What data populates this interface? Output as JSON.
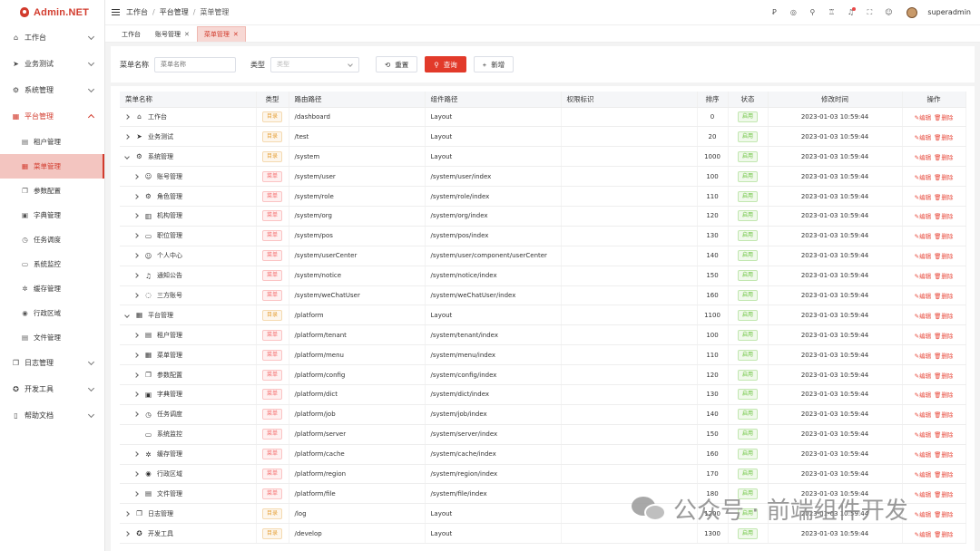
{
  "app": {
    "logo_text": "Admin.NET"
  },
  "sidebar": {
    "items": [
      {
        "label": "工作台",
        "icon": "home-icon",
        "glyph": "⌂"
      },
      {
        "label": "业务测试",
        "icon": "send-icon",
        "glyph": "➤"
      },
      {
        "label": "系统管理",
        "icon": "settings-icon",
        "glyph": "⚙"
      },
      {
        "label": "平台管理",
        "icon": "grid-icon",
        "glyph": "▦"
      }
    ],
    "sub_items": [
      {
        "label": "租户管理",
        "icon": "tenant-icon",
        "glyph": "▤"
      },
      {
        "label": "菜单管理",
        "icon": "menu-grid-icon",
        "glyph": "▦"
      },
      {
        "label": "参数配置",
        "icon": "copy-icon",
        "glyph": "❐"
      },
      {
        "label": "字典管理",
        "icon": "book-icon",
        "glyph": "▣"
      },
      {
        "label": "任务调度",
        "icon": "timer-icon",
        "glyph": "◷"
      },
      {
        "label": "系统监控",
        "icon": "monitor-icon",
        "glyph": "▭"
      },
      {
        "label": "缓存管理",
        "icon": "sun-icon",
        "glyph": "✲"
      },
      {
        "label": "行政区域",
        "icon": "location-icon",
        "glyph": "◉"
      },
      {
        "label": "文件管理",
        "icon": "file-icon",
        "glyph": "▤"
      }
    ],
    "bottom_items": [
      {
        "label": "日志管理",
        "icon": "log-icon",
        "glyph": "❐"
      },
      {
        "label": "开发工具",
        "icon": "tool-icon",
        "glyph": "✪"
      },
      {
        "label": "帮助文档",
        "icon": "doc-icon",
        "glyph": "▯"
      }
    ]
  },
  "header": {
    "breadcrumb": [
      "工作台",
      "平台管理",
      "菜单管理"
    ],
    "breadcrumb_sep": "/",
    "tools": [
      {
        "icon": "translate-icon",
        "glyph": "Ꝑ"
      },
      {
        "icon": "target-icon",
        "glyph": "◎"
      },
      {
        "icon": "search-icon",
        "glyph": "⚲"
      },
      {
        "icon": "shirt-icon",
        "glyph": "♖"
      },
      {
        "icon": "bell-icon",
        "glyph": "♫"
      },
      {
        "icon": "fullscreen-icon",
        "glyph": "⛶"
      },
      {
        "icon": "user-icon",
        "glyph": "☺"
      }
    ],
    "username": "superadmin"
  },
  "tabs": [
    {
      "label": "工作台",
      "closable": false
    },
    {
      "label": "账号管理",
      "closable": true
    },
    {
      "label": "菜单管理",
      "closable": true
    }
  ],
  "tab_close": "✕",
  "filter": {
    "name_label": "菜单名称",
    "name_placeholder": "菜单名称",
    "type_label": "类型",
    "type_placeholder": "类型",
    "reset_label": "重置",
    "reset_icon": "⟲",
    "query_label": "查询",
    "query_icon": "⚲",
    "add_label": "新增",
    "add_icon": "+"
  },
  "table": {
    "columns": [
      "菜单名称",
      "类型",
      "路由路径",
      "组件路径",
      "权限标识",
      "排序",
      "状态",
      "修改时间",
      "操作"
    ],
    "ops": {
      "edit": "编辑",
      "delete": "删除",
      "edit_icon": "✎",
      "delete_icon": "🗑"
    },
    "rows": [
      {
        "level": 0,
        "tree": "closed",
        "icon": "⌂",
        "name": "工作台",
        "type": "目录",
        "kind": "dir",
        "path": "/dashboard",
        "component": "Layout",
        "perm": "",
        "order": "0",
        "status": "启用",
        "time": "2023-01-03 10:59:44"
      },
      {
        "level": 0,
        "tree": "closed",
        "icon": "➤",
        "name": "业务测试",
        "type": "目录",
        "kind": "dir",
        "path": "/test",
        "component": "Layout",
        "perm": "",
        "order": "20",
        "status": "启用",
        "time": "2023-01-03 10:59:44"
      },
      {
        "level": 0,
        "tree": "open",
        "icon": "⚙",
        "name": "系统管理",
        "type": "目录",
        "kind": "dir",
        "path": "/system",
        "component": "Layout",
        "perm": "",
        "order": "1000",
        "status": "启用",
        "time": "2023-01-03 10:59:44"
      },
      {
        "level": 1,
        "tree": "closed",
        "icon": "☺",
        "name": "账号管理",
        "type": "菜单",
        "kind": "menu",
        "path": "/system/user",
        "component": "/system/user/index",
        "perm": "",
        "order": "100",
        "status": "启用",
        "time": "2023-01-03 10:59:44"
      },
      {
        "level": 1,
        "tree": "closed",
        "icon": "⚙",
        "name": "角色管理",
        "type": "菜单",
        "kind": "menu",
        "path": "/system/role",
        "component": "/system/role/index",
        "perm": "",
        "order": "110",
        "status": "启用",
        "time": "2023-01-03 10:59:44"
      },
      {
        "level": 1,
        "tree": "closed",
        "icon": "▥",
        "name": "机构管理",
        "type": "菜单",
        "kind": "menu",
        "path": "/system/org",
        "component": "/system/org/index",
        "perm": "",
        "order": "120",
        "status": "启用",
        "time": "2023-01-03 10:59:44"
      },
      {
        "level": 1,
        "tree": "closed",
        "icon": "▭",
        "name": "职位管理",
        "type": "菜单",
        "kind": "menu",
        "path": "/system/pos",
        "component": "/system/pos/index",
        "perm": "",
        "order": "130",
        "status": "启用",
        "time": "2023-01-03 10:59:44"
      },
      {
        "level": 1,
        "tree": "closed",
        "icon": "☺",
        "name": "个人中心",
        "type": "菜单",
        "kind": "menu",
        "path": "/system/userCenter",
        "component": "/system/user/component/userCenter",
        "perm": "",
        "order": "140",
        "status": "启用",
        "time": "2023-01-03 10:59:44"
      },
      {
        "level": 1,
        "tree": "closed",
        "icon": "♫",
        "name": "通知公告",
        "type": "菜单",
        "kind": "menu",
        "path": "/system/notice",
        "component": "/system/notice/index",
        "perm": "",
        "order": "150",
        "status": "启用",
        "time": "2023-01-03 10:59:44"
      },
      {
        "level": 1,
        "tree": "closed",
        "icon": "◌",
        "name": "三方账号",
        "type": "菜单",
        "kind": "menu",
        "path": "/system/weChatUser",
        "component": "/system/weChatUser/index",
        "perm": "",
        "order": "160",
        "status": "启用",
        "time": "2023-01-03 10:59:44"
      },
      {
        "level": 0,
        "tree": "open",
        "icon": "▦",
        "name": "平台管理",
        "type": "目录",
        "kind": "dir",
        "path": "/platform",
        "component": "Layout",
        "perm": "",
        "order": "1100",
        "status": "启用",
        "time": "2023-01-03 10:59:44"
      },
      {
        "level": 1,
        "tree": "closed",
        "icon": "▤",
        "name": "租户管理",
        "type": "菜单",
        "kind": "menu",
        "path": "/platform/tenant",
        "component": "/system/tenant/index",
        "perm": "",
        "order": "100",
        "status": "启用",
        "time": "2023-01-03 10:59:44"
      },
      {
        "level": 1,
        "tree": "closed",
        "icon": "▦",
        "name": "菜单管理",
        "type": "菜单",
        "kind": "menu",
        "path": "/platform/menu",
        "component": "/system/menu/index",
        "perm": "",
        "order": "110",
        "status": "启用",
        "time": "2023-01-03 10:59:44"
      },
      {
        "level": 1,
        "tree": "closed",
        "icon": "❐",
        "name": "参数配置",
        "type": "菜单",
        "kind": "menu",
        "path": "/platform/config",
        "component": "/system/config/index",
        "perm": "",
        "order": "120",
        "status": "启用",
        "time": "2023-01-03 10:59:44"
      },
      {
        "level": 1,
        "tree": "closed",
        "icon": "▣",
        "name": "字典管理",
        "type": "菜单",
        "kind": "menu",
        "path": "/platform/dict",
        "component": "/system/dict/index",
        "perm": "",
        "order": "130",
        "status": "启用",
        "time": "2023-01-03 10:59:44"
      },
      {
        "level": 1,
        "tree": "closed",
        "icon": "◷",
        "name": "任务调度",
        "type": "菜单",
        "kind": "menu",
        "path": "/platform/job",
        "component": "/system/job/index",
        "perm": "",
        "order": "140",
        "status": "启用",
        "time": "2023-01-03 10:59:44"
      },
      {
        "level": 1,
        "tree": "none",
        "icon": "▭",
        "name": "系统监控",
        "type": "菜单",
        "kind": "menu",
        "path": "/platform/server",
        "component": "/system/server/index",
        "perm": "",
        "order": "150",
        "status": "启用",
        "time": "2023-01-03 10:59:44"
      },
      {
        "level": 1,
        "tree": "closed",
        "icon": "✲",
        "name": "缓存管理",
        "type": "菜单",
        "kind": "menu",
        "path": "/platform/cache",
        "component": "/system/cache/index",
        "perm": "",
        "order": "160",
        "status": "启用",
        "time": "2023-01-03 10:59:44"
      },
      {
        "level": 1,
        "tree": "closed",
        "icon": "◉",
        "name": "行政区域",
        "type": "菜单",
        "kind": "menu",
        "path": "/platform/region",
        "component": "/system/region/index",
        "perm": "",
        "order": "170",
        "status": "启用",
        "time": "2023-01-03 10:59:44"
      },
      {
        "level": 1,
        "tree": "closed",
        "icon": "▤",
        "name": "文件管理",
        "type": "菜单",
        "kind": "menu",
        "path": "/platform/file",
        "component": "/system/file/index",
        "perm": "",
        "order": "180",
        "status": "启用",
        "time": "2023-01-03 10:59:44"
      },
      {
        "level": 0,
        "tree": "closed",
        "icon": "❐",
        "name": "日志管理",
        "type": "目录",
        "kind": "dir",
        "path": "/log",
        "component": "Layout",
        "perm": "",
        "order": "1200",
        "status": "启用",
        "time": "2023-01-03 10:59:44"
      },
      {
        "level": 0,
        "tree": "closed",
        "icon": "✪",
        "name": "开发工具",
        "type": "目录",
        "kind": "dir",
        "path": "/develop",
        "component": "Layout",
        "perm": "",
        "order": "1300",
        "status": "启用",
        "time": "2023-01-03 10:59:44"
      }
    ]
  },
  "watermark": {
    "text": "公众号 · 前端组件开发"
  },
  "colors": {
    "accent": "#e23a2a",
    "selected_bg": "#f3c5c0",
    "tag_dir": "#e6a23c",
    "tag_menu": "#f56c6c",
    "tag_on": "#67c23a"
  }
}
